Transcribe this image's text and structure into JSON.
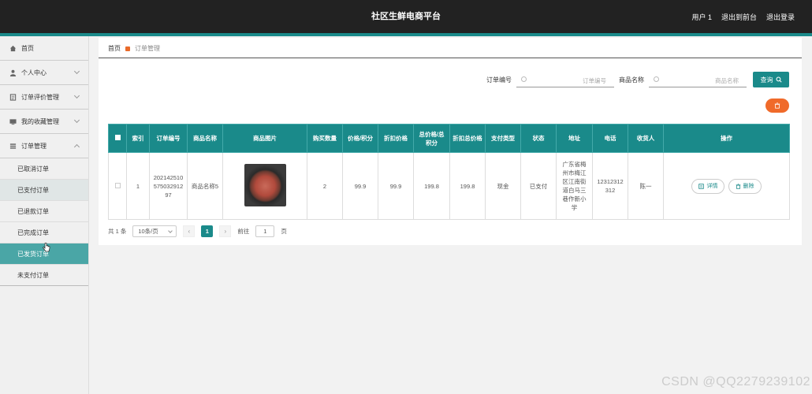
{
  "header": {
    "title": "社区生鲜电商平台",
    "user": "用户 1",
    "back_to_front": "退出到前台",
    "logout": "退出登录"
  },
  "sidebar": {
    "items": [
      {
        "label": "首页",
        "icon": "home-icon"
      },
      {
        "label": "个人中心",
        "icon": "user-icon"
      },
      {
        "label": "订单评价管理",
        "icon": "doc-icon"
      },
      {
        "label": "我的收藏管理",
        "icon": "monitor-icon"
      },
      {
        "label": "订单管理",
        "icon": "list-icon"
      }
    ],
    "sub_items": [
      "已取消订单",
      "已支付订单",
      "已退款订单",
      "已完成订单",
      "已发货订单",
      "未支付订单"
    ]
  },
  "breadcrumb": {
    "home": "首页",
    "current": "订单管理"
  },
  "search": {
    "order_no_label": "订单编号",
    "order_no_placeholder": "订单编号",
    "product_name_label": "商品名称",
    "product_name_placeholder": "商品名称",
    "query_label": "查询"
  },
  "table": {
    "headers": [
      "索引",
      "订单编号",
      "商品名称",
      "商品图片",
      "购买数量",
      "价格/积分",
      "折扣价格",
      "总价格/总积分",
      "折扣总价格",
      "支付类型",
      "状态",
      "地址",
      "电话",
      "收货人",
      "操作"
    ],
    "rows": [
      {
        "index": "1",
        "order_no": "20214251057503291297",
        "product_name": "商品名称5",
        "qty": "2",
        "price": "99.9",
        "discount_price": "99.9",
        "total": "199.8",
        "discount_total": "199.8",
        "pay_type": "现金",
        "status": "已支付",
        "address": "广东省梅州市梅江区江南街道白马三巷作新小学",
        "phone": "12312312312",
        "receiver": "陈一",
        "detail_label": "详情",
        "delete_label": "删除"
      }
    ]
  },
  "pager": {
    "total": "共 1 条",
    "page_size": "10条/页",
    "current_page": "1",
    "goto_label": "前往",
    "goto_value": "1",
    "page_suffix": "页"
  },
  "watermark": "CSDN @QQ2279239102",
  "colors": {
    "accent": "#1a8a8a",
    "header": "#222222",
    "danger": "#f06a2a"
  }
}
